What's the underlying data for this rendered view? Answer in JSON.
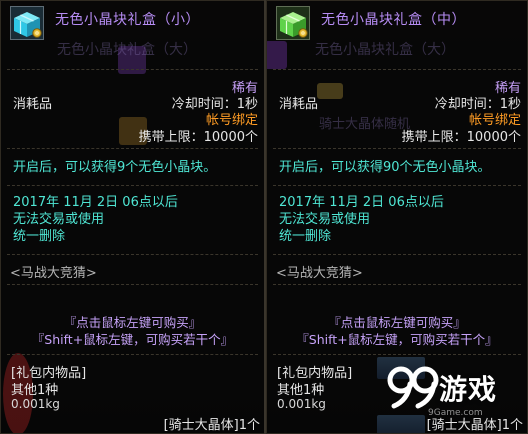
{
  "tooltips": [
    {
      "title": "无色小晶块礼盒（小）",
      "ghost_title": "无色小晶块礼盒（大）",
      "rarity": "稀有",
      "category": "消耗品",
      "cooldown": "冷却时间：1秒",
      "bind": "帐号绑定",
      "limit": "携带上限：10000个",
      "description": "开启后，可以获得9个无色小晶块。",
      "expire_line1": "2017年 11月 2日 06点以后",
      "expire_line2": "无法交易或使用",
      "expire_line3": "统一删除",
      "event": "<马战大竞猜>",
      "buy_line1": "『点击鼠标左键可购买』",
      "buy_line2": "『Shift+鼠标左键，可购买若干个』",
      "contents_title": "[礼包内物品]",
      "other_count": "其他1种",
      "weight": "0.001kg",
      "content_item": "[骑士大晶体]1个",
      "icon_color": "#2fc7e6"
    },
    {
      "title": "无色小晶块礼盒（中）",
      "ghost_title": "无色小晶块礼盒（大）",
      "ghost_subtitle": "骑士大晶体随机",
      "rarity": "稀有",
      "category": "消耗品",
      "cooldown": "冷却时间：1秒",
      "bind": "帐号绑定",
      "limit": "携带上限：10000个",
      "description": "开启后，可以获得90个无色小晶块。",
      "expire_line1": "2017年 11月 2日 06点以后",
      "expire_line2": "无法交易或使用",
      "expire_line3": "统一删除",
      "event": "<马战大竞猜>",
      "buy_line1": "『点击鼠标左键可购买』",
      "buy_line2": "『Shift+鼠标左键，可购买若干个』",
      "contents_title": "[礼包内物品]",
      "other_count": "其他1种",
      "weight": "0.001kg",
      "content_item": "[骑士大晶体]1个",
      "icon_color": "#5fd24a"
    }
  ],
  "watermark": {
    "brand_text": "游戏",
    "url": "9Game.com"
  },
  "colors": {
    "title": "#b68cf3",
    "rarity": "#c49ef5",
    "bind": "#ff9c24",
    "desc": "#4fe6d4",
    "text": "#e6e6e6"
  }
}
